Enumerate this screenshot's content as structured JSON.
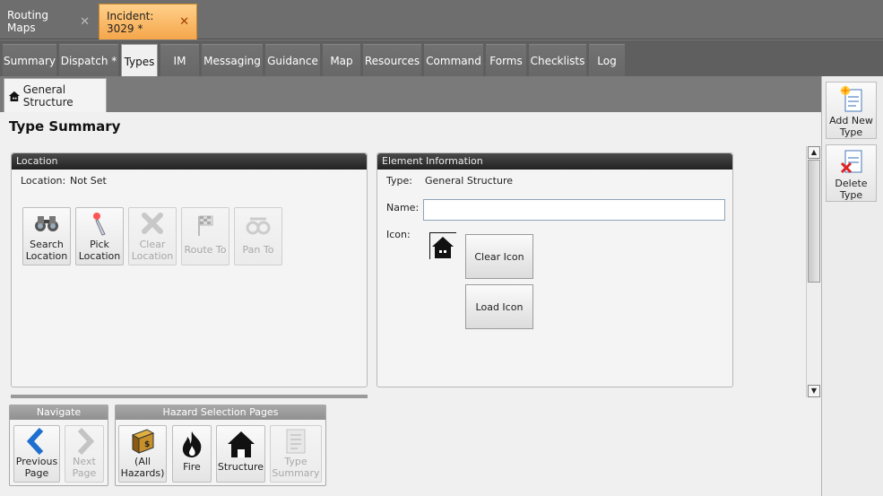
{
  "top_tabs": [
    {
      "label": "Routing Maps",
      "active": false
    },
    {
      "label": "Incident: 3029 *",
      "active": true
    }
  ],
  "nav_tabs": [
    "Summary",
    "Dispatch *",
    "Types",
    "IM",
    "Messaging",
    "Guidance",
    "Map",
    "Resources",
    "Command",
    "Forms",
    "Checklists",
    "Log"
  ],
  "nav_active": "Types",
  "sub_tab": {
    "label": "General Structure",
    "icon": "house-icon"
  },
  "page_title": "Type Summary",
  "location_panel": {
    "header": "Location",
    "location_label": "Location:",
    "location_value": "Not Set",
    "buttons": [
      {
        "line1": "Search",
        "line2": "Location",
        "icon": "binoculars-icon",
        "enabled": true
      },
      {
        "line1": "Pick",
        "line2": "Location",
        "icon": "pointer-icon",
        "enabled": true
      },
      {
        "line1": "Clear",
        "line2": "Location",
        "icon": "clear-x-icon",
        "enabled": false
      },
      {
        "line1": "Route To",
        "line2": "",
        "icon": "flag-icon",
        "enabled": false
      },
      {
        "line1": "Pan To",
        "line2": "",
        "icon": "pan-icon",
        "enabled": false
      }
    ]
  },
  "element_panel": {
    "header": "Element Information",
    "type_label": "Type:",
    "type_value": "General Structure",
    "name_label": "Name:",
    "name_value": "",
    "icon_label": "Icon:",
    "clear_icon": "Clear Icon",
    "load_icon": "Load Icon"
  },
  "navigate": {
    "header": "Navigate",
    "previous": {
      "line1": "Previous",
      "line2": "Page"
    },
    "next": {
      "line1": "Next",
      "line2": "Page"
    }
  },
  "hazard": {
    "header": "Hazard Selection Pages",
    "all": {
      "line1": "(All",
      "line2": "Hazards)"
    },
    "fire": "Fire",
    "structure": "Structure",
    "type_summary": {
      "line1": "Type",
      "line2": "Summary"
    }
  },
  "sidebar": {
    "add": {
      "line1": "Add New",
      "line2": "Type"
    },
    "delete": {
      "line1": "Delete",
      "line2": "Type"
    }
  },
  "colors": {
    "active_tab": "#f5a64b",
    "panel_header": "#2a2a2a"
  }
}
